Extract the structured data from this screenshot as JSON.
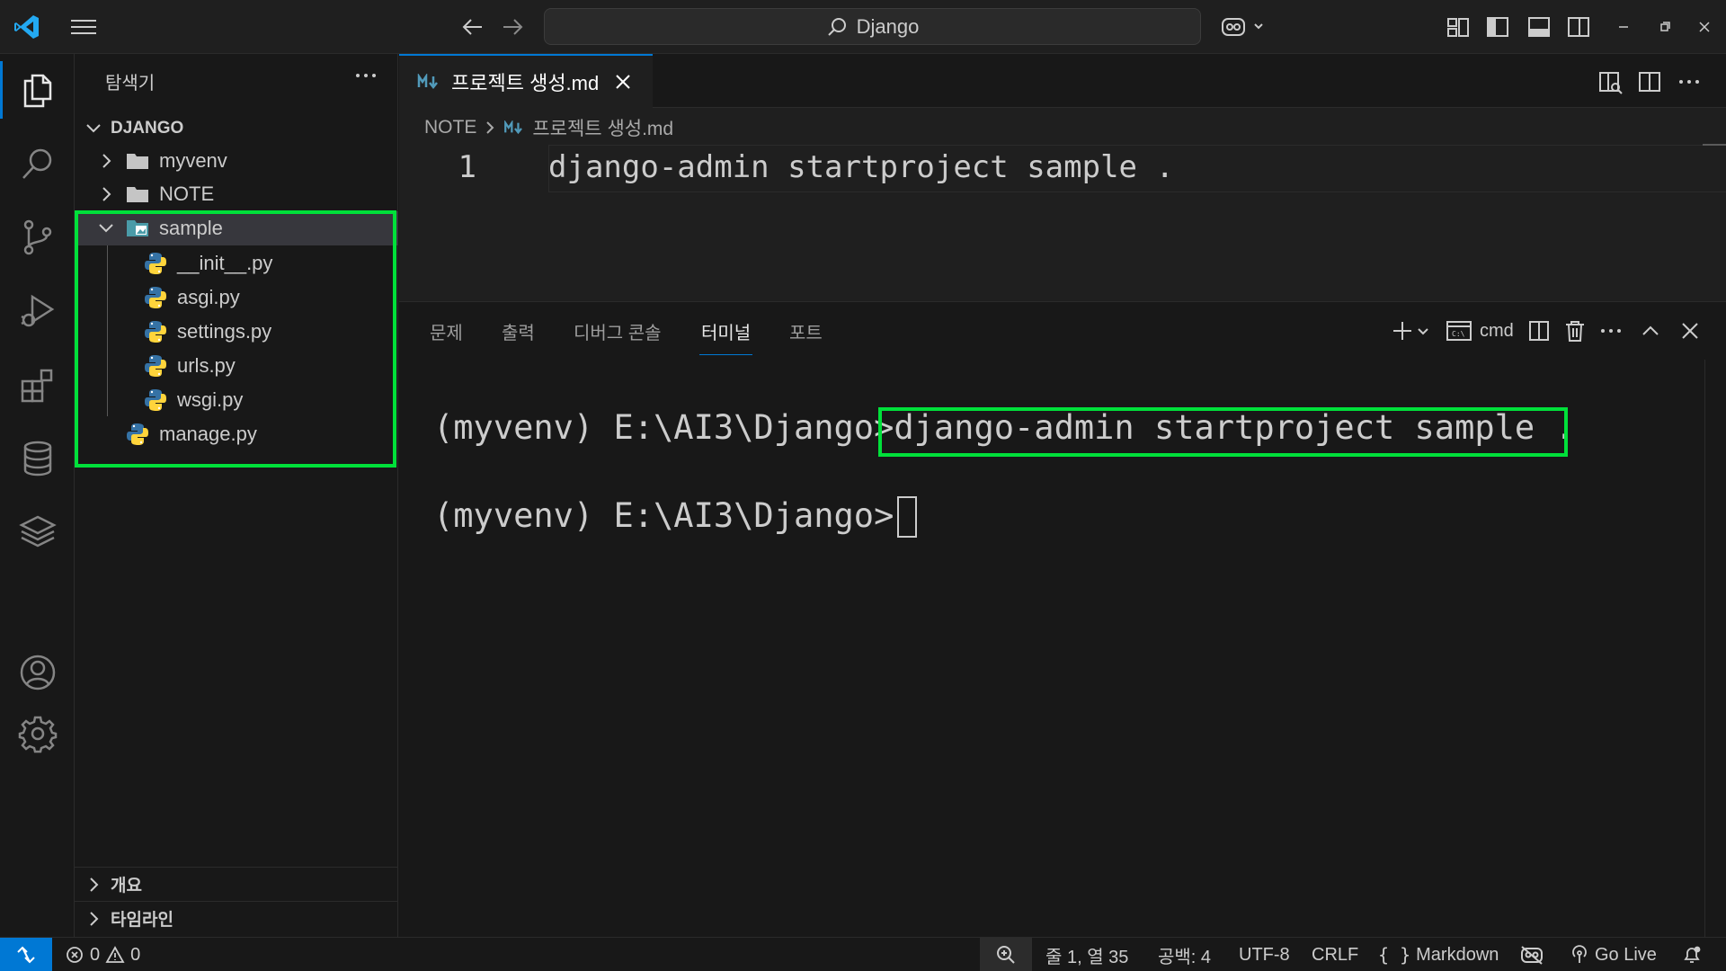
{
  "window": {
    "search_text": "Django"
  },
  "sidebar": {
    "title": "탐색기",
    "folder": "DJANGO",
    "tree": [
      {
        "label": "myvenv",
        "kind": "folder",
        "expanded": false
      },
      {
        "label": "NOTE",
        "kind": "folder",
        "expanded": false
      },
      {
        "label": "sample",
        "kind": "folder",
        "expanded": true,
        "selected": true
      },
      {
        "label": "__init__.py",
        "kind": "python"
      },
      {
        "label": "asgi.py",
        "kind": "python"
      },
      {
        "label": "settings.py",
        "kind": "python"
      },
      {
        "label": "urls.py",
        "kind": "python"
      },
      {
        "label": "wsgi.py",
        "kind": "python"
      },
      {
        "label": "manage.py",
        "kind": "python"
      }
    ],
    "sections": [
      "개요",
      "타임라인"
    ]
  },
  "editor": {
    "tab_label": "프로젝트 생성.md",
    "breadcrumb": [
      "NOTE",
      "프로젝트 생성.md"
    ],
    "line_number": "1",
    "code": "django-admin startproject sample ."
  },
  "panel": {
    "tabs": [
      "문제",
      "출력",
      "디버그 콘솔",
      "터미널",
      "포트"
    ],
    "active_tab": "터미널",
    "terminal_name": "cmd",
    "lines": [
      {
        "prompt": "(myvenv) E:\\AI3\\Django>",
        "command": "django-admin startproject sample ."
      },
      {
        "prompt": "(myvenv) E:\\AI3\\Django>",
        "command": ""
      }
    ]
  },
  "statusbar": {
    "errors": "0",
    "warnings": "0",
    "position": "줄 1, 열 35",
    "spaces": "공백: 4",
    "encoding": "UTF-8",
    "eol": "CRLF",
    "language": "Markdown",
    "go_live": "Go Live"
  },
  "colors": {
    "accent": "#0078d4",
    "highlight": "#00e03a",
    "background": "#181818",
    "editor_bg": "#1f1f1f",
    "python_blue": "#3572a5",
    "python_yellow": "#ffd43b"
  },
  "icons": [
    "vscode-logo-icon",
    "menu-icon",
    "arrow-left-icon",
    "arrow-right-icon",
    "search-icon",
    "copilot-icon",
    "files-icon",
    "source-control-icon",
    "run-debug-icon",
    "extensions-icon",
    "database-icon",
    "layers-icon",
    "account-icon",
    "gear-icon",
    "markdown-icon",
    "python-icon",
    "folder-icon",
    "terminal-icon",
    "trash-icon",
    "bell-icon"
  ]
}
